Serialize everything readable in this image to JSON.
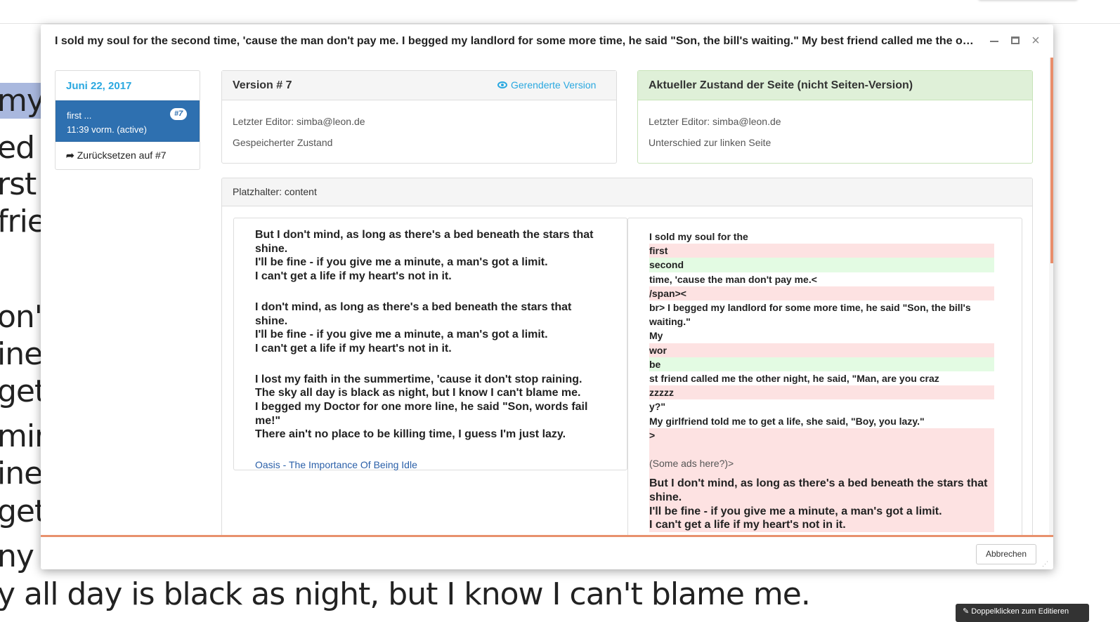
{
  "background": {
    "lines": [
      {
        "text": "my s",
        "highlight": true
      },
      {
        "text": "ed r",
        "highlight": false
      },
      {
        "text": "rst",
        "highlight": false
      },
      {
        "text": "frie",
        "highlight": false
      },
      {
        "text": "",
        "highlight": false
      },
      {
        "text": "on't",
        "highlight": false
      },
      {
        "text": "ine",
        "highlight": false
      },
      {
        "text": "get",
        "highlight": false
      },
      {
        "text": "mir",
        "highlight": false
      },
      {
        "text": "ine",
        "highlight": false
      },
      {
        "text": "get",
        "highlight": false
      },
      {
        "text": "ny fa",
        "highlight": false
      },
      {
        "text": "y all day is black as night, but I know I can't blame me.",
        "highlight": false
      }
    ],
    "edit_badge": "Doppelklicken zum Editieren"
  },
  "modal": {
    "title": "I sold my soul for the second time, 'cause the man don't pay me. I begged my landlord for some more time, he said \"Son, the bill's waiting.\" My best friend called me the other night, he said, \"Man, are you crazy?\" My girlfriend told me to get a life, she said, \"Boy, you lazy.\"",
    "controls": {
      "minimize": "minimize",
      "maximize": "maximize",
      "close": "×"
    }
  },
  "timeline": {
    "date": "Juni 22, 2017",
    "entry": {
      "title": "first ...",
      "time": "11:39 vorm. (active)",
      "badge": "#7"
    },
    "revert": {
      "arrow": "➦",
      "label": "Zurücksetzen auf #7"
    }
  },
  "version_panel": {
    "title": "Version # 7",
    "rendered_link": "Gerenderte Version",
    "editor": "Letzter Editor: simba@leon.de",
    "state": "Gespeicherter Zustand"
  },
  "current_panel": {
    "title": "Aktueller Zustand der Seite (nicht Seiten-Version)",
    "editor": "Letzter Editor: simba@leon.de",
    "state": "Unterschied zur linken Seite"
  },
  "placeholder": {
    "title": "Platzhalter: content",
    "left": {
      "paragraphs": [
        [
          "But I don't mind, as long as there's a bed beneath the stars that shine.",
          "I'll be fine - if you give me a minute, a man's got a limit.",
          "I can't get a life if my heart's not in it."
        ],
        [
          "I don't mind, as long as there's a bed beneath the stars that shine.",
          "I'll be fine - if you give me a minute, a man's got a limit.",
          "I can't get a life if my heart's not in it."
        ],
        [
          "I lost my faith in the summertime, 'cause it don't stop raining.",
          "The sky all day is black as night, but I know I can't blame me.",
          "I begged my Doctor for one more line, he said \"Son, words fail me!\"",
          "There ain't no place to be killing time, I guess I'm just lazy."
        ]
      ],
      "link": "Oasis - The Importance Of Being Idle"
    },
    "right": {
      "lines": [
        {
          "text": "I sold my soul for the",
          "kind": "plain"
        },
        {
          "text": "first",
          "kind": "del"
        },
        {
          "text": "second",
          "kind": "ins"
        },
        {
          "text": "time, 'cause the man don't pay me.<",
          "kind": "plain"
        },
        {
          "text": "/span><",
          "kind": "del"
        },
        {
          "text": "br> I begged my landlord for some more time, he said \"Son, the bill's waiting.\"",
          "kind": "plain"
        },
        {
          "text": "My",
          "kind": "plain"
        },
        {
          "text": "wor",
          "kind": "del"
        },
        {
          "text": "be",
          "kind": "ins"
        },
        {
          "text": "st friend called me the other night, he said, \"Man, are you craz",
          "kind": "plain"
        },
        {
          "text": "zzzzz",
          "kind": "del"
        },
        {
          "text": "y?\"",
          "kind": "plain"
        },
        {
          "text": "My girlfriend told me to get a life, she said, \"Boy, you lazy.\"",
          "kind": "plain"
        },
        {
          "text": ">",
          "kind": "del"
        },
        {
          "text": "",
          "kind": "del-spacer"
        },
        {
          "text": "(Some ads here?)>",
          "kind": "del-ads"
        },
        {
          "text": "",
          "kind": "del-gap"
        },
        {
          "text": "But I don't mind, as long as there's a bed beneath the stars that shine.",
          "kind": "del-big"
        },
        {
          "text": "I'll be fine - if you give me a minute, a man's got a limit.",
          "kind": "del-big"
        },
        {
          "text": "I can't get a life if my heart's not in it.",
          "kind": "del-big"
        }
      ]
    }
  },
  "footer": {
    "cancel": "Abbrechen",
    "grip": "⋰"
  }
}
